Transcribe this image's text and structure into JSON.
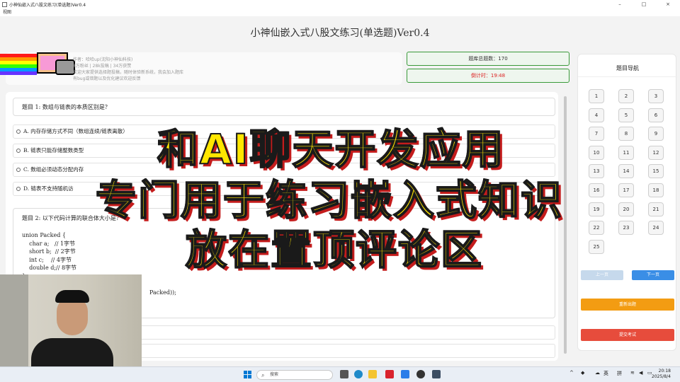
{
  "window": {
    "title": "小神仙嵌入式八股文练习(单选题)Ver0.4",
    "menu": "视图",
    "controls": [
      "–",
      "□",
      "×"
    ]
  },
  "app_title": "小神仙嵌入式八股文练习(单选题)Ver0.4",
  "info": {
    "lines": [
      "作者：哈哈up(沈阳小神仙科技)",
      "8万粉丝 | 28k投稿 | 34万获赞",
      "欢迎大家提供选择题投稿，随时体验新系统，我会加入题库",
      "有bug或错题以及优化建议欢迎反馈"
    ]
  },
  "stats": {
    "total": "题库总题数：170",
    "timer": "倒计时：19:48"
  },
  "question1": {
    "title": "题目 1: 数组与链表的本质区别是？",
    "options": [
      "A. 内存存储方式不同（数组连续/链表离散）",
      "B. 链表只能存储整数类型",
      "C. 数组必须动态分配内存",
      "D. 链表不支持随机访"
    ]
  },
  "question2": {
    "title": "题目 2: 以下代码计算的联合体大小是？",
    "code": "union Packed {\n    char a;   // 1字节\n    short b;  // 2字节\n    int c;    // 4字节\n    double d;// 8字节\n};",
    "tail": "Packed));"
  },
  "nav": {
    "title": "题目导航",
    "numbers": [
      "1",
      "2",
      "3",
      "4",
      "5",
      "6",
      "7",
      "8",
      "9",
      "10",
      "11",
      "12",
      "13",
      "14",
      "15",
      "16",
      "17",
      "18",
      "19",
      "20",
      "21",
      "22",
      "23",
      "24",
      "25"
    ],
    "prev": "上一页",
    "next": "下一页",
    "reset": "重新出题",
    "submit": "提交考试"
  },
  "overlay": {
    "line1": "和AI聊天开发应用",
    "line2": "专门用于练习嵌入式知识",
    "line3": "放在置顶评论区"
  },
  "taskbar": {
    "search": "搜索",
    "ime1": "英",
    "ime2": "拼",
    "time": "20:18",
    "date": "2025/8/4"
  },
  "colors": {
    "accent_green": "#3a9a3a",
    "timer_red": "#dd2222",
    "next_blue": "#3a8ee6",
    "reset_orange": "#f39c12",
    "submit_red": "#e74c3c",
    "overlay_yellow": "#ffe600"
  }
}
